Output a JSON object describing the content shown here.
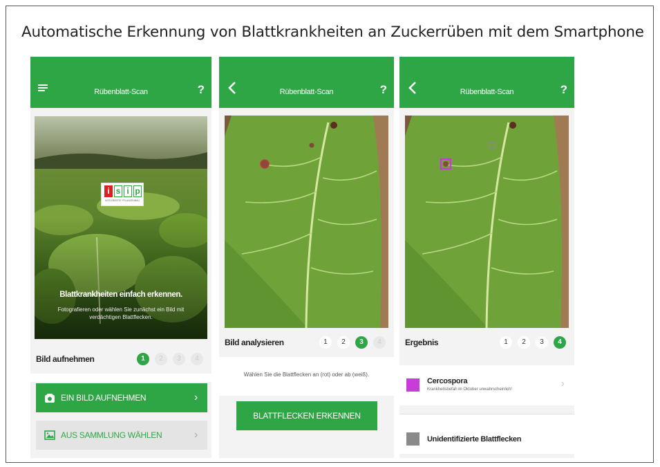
{
  "page": {
    "title": "Automatische Erkennung von Blattkrankheiten an Zuckerrüben mit dem Smartphone"
  },
  "colors": {
    "brand_green": "#2ea646",
    "cercospora": "#c83cdc",
    "unidentified": "#8a8a8a"
  },
  "screens": [
    {
      "app_title": "Rübenblatt-Scan",
      "help": "?",
      "nav_icon": "menu-icon",
      "hero": {
        "logo_letters": [
          "i",
          "s",
          "i",
          "p"
        ],
        "logo_tagline": "INTEGRIERTE PFLANZENBAU",
        "headline": "Blattkrankheiten einfach erkennen.",
        "subtext": "Fotografieren oder wählen Sie zunächst ein Bild mit verdächtigen Blattflecken."
      },
      "step_label": "Bild aufnehmen",
      "steps": [
        "1",
        "2",
        "3",
        "4"
      ],
      "active_step": 0,
      "buttons": [
        {
          "label": "EIN BILD AUFNEHMEN",
          "icon": "camera-icon"
        },
        {
          "label": "AUS SAMMLUNG WÄHLEN",
          "icon": "gallery-icon"
        }
      ]
    },
    {
      "app_title": "Rübenblatt-Scan",
      "help": "?",
      "nav_icon": "back-icon",
      "step_label": "Bild analysieren",
      "steps": [
        "1",
        "2",
        "3",
        "4"
      ],
      "active_step": 2,
      "hint": "Wählen Sie die Blattflecken an (rot) oder ab (weiß).",
      "action_button": "BLATTFLECKEN ERKENNEN"
    },
    {
      "app_title": "Rübenblatt-Scan",
      "help": "?",
      "nav_icon": "back-icon",
      "step_label": "Ergebnis",
      "steps": [
        "1",
        "2",
        "3",
        "4"
      ],
      "active_step": 3,
      "results": [
        {
          "name": "Cercospora",
          "detail": "Krankheitsbefall im Oktober unwahrscheinlich!"
        },
        {
          "name": "Unidentifizierte Blattflecken",
          "detail": ""
        }
      ]
    }
  ]
}
